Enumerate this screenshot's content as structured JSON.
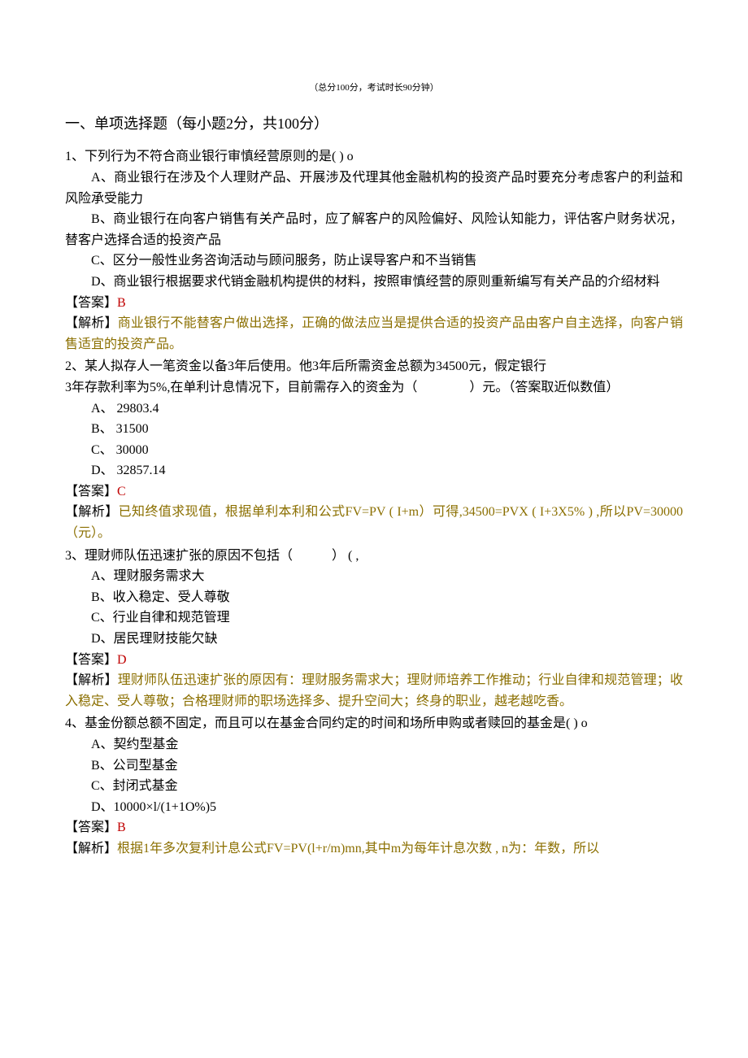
{
  "exam_info": "（总分100分，考试时长90分钟）",
  "section_header": "一、单项选择题（每小题2分，共100分）",
  "q1": {
    "stem": "1、下列行为不符合商业银行审慎经营原则的是( ) o",
    "optA": "A、商业银行在涉及个人理财产品、开展涉及代理其他金融机构的投资产品时要充分考虑客户的利益和风险承受能力",
    "optB": "B、商业银行在向客户销售有关产品时，应了解客户的风险偏好、风险认知能力，评估客户财务状况，替客户选择合适的投资产品",
    "optC": "C、区分一般性业务咨询活动与顾问服务，防止误导客户和不当销售",
    "optD": "D、商业银行根据要求代销金融机构提供的材料，按照审慎经营的原则重新编写有关产品的介绍材料",
    "answer_label": "【答案】",
    "answer_val": "B",
    "analysis_label": "【解析】",
    "analysis_text": "商业银行不能替客户做出选择，正确的做法应当是提供合适的投资产品由客户自主选择，向客户销售适宜的投资产品。"
  },
  "q2": {
    "stem1": "2、某人拟存人一笔资金以备3年后使用。他3年后所需资金总额为34500元，假定银行",
    "stem2": "3年存款利率为5%,在单利计息情况下，目前需存入的资金为（　　　　）元。（答案取近似数值）",
    "optA": "A、 29803.4",
    "optB": "B、 31500",
    "optC": "C、 30000",
    "optD": "D、 32857.14",
    "answer_label": "【答案】",
    "answer_val": "C",
    "analysis_label": "【解析】",
    "analysis_text": "已知终值求现值，根据单利本利和公式FV=PV ( I+m）可得,34500=PVX ( I+3X5% ) ,所以PV=30000（元）。"
  },
  "q3": {
    "stem": "3、理财师队伍迅速扩张的原因不包括（　　　） ( ,",
    "optA": "A、理财服务需求大",
    "optB": "B、收入稳定、受人尊敬",
    "optC": "C、行业自律和规范管理",
    "optD": "D、居民理财技能欠缺",
    "answer_label": "【答案】",
    "answer_val": "D",
    "analysis_label": "【解析】",
    "analysis_text": "理财师队伍迅速扩张的原因有：理财服务需求大；理财师培养工作推动；行业自律和规范管理；收入稳定、受人尊敬；合格理财师的职场选择多、提升空间大；终身的职业，越老越吃香。"
  },
  "q4": {
    "stem": "4、基金份额总额不固定，而且可以在基金合同约定的时间和场所申购或者赎回的基金是( ) o",
    "optA": "A、契约型基金",
    "optB": "B、公司型基金",
    "optC": "C、封闭式基金",
    "optD": "D、10000×l/(1+1O%)5",
    "answer_label": "【答案】",
    "answer_val": "B",
    "analysis_label": "【解析】",
    "analysis_text": "根据1年多次复利计息公式FV=PV(l+r/m)mn,其中m为每年计息次数 , n为：年数，所以"
  }
}
